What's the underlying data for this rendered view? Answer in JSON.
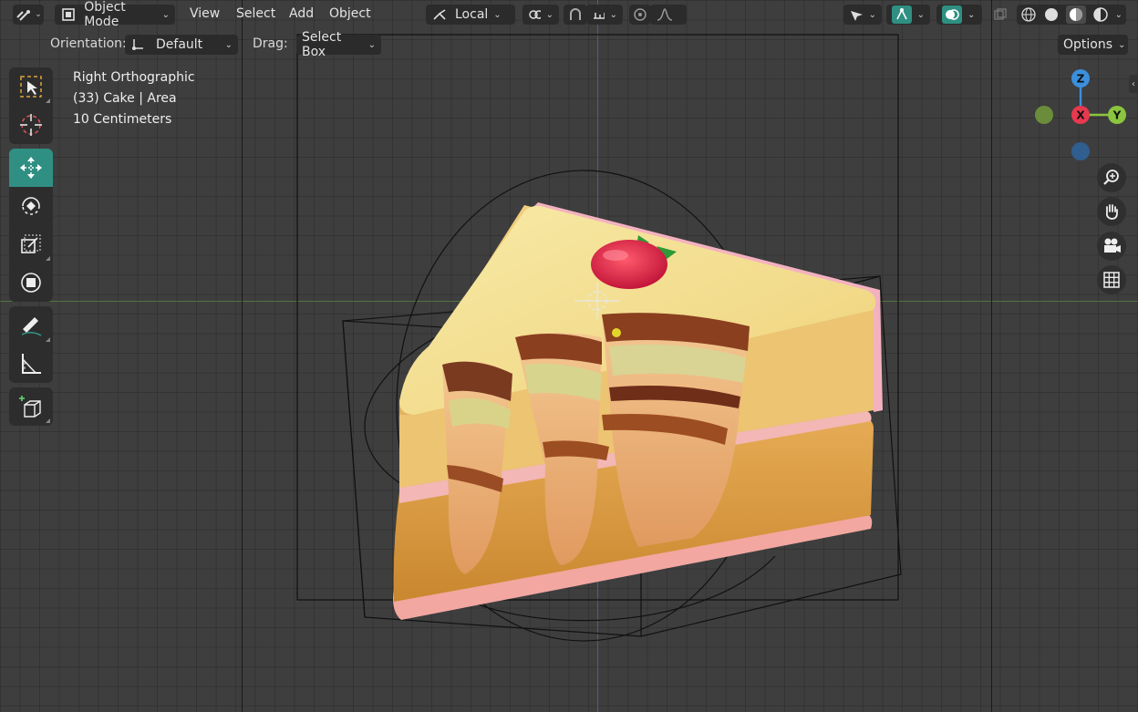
{
  "header": {
    "mode_label": "Object Mode",
    "menus": [
      "View",
      "Select",
      "Add",
      "Object"
    ],
    "transform_orientation": "Local"
  },
  "tool_header": {
    "orientation_label": "Orientation:",
    "orientation_value": "Default",
    "drag_label": "Drag:",
    "drag_value": "Select Box",
    "options_label": "Options"
  },
  "overlay": {
    "view_name": "Right Orthographic",
    "object_info": "(33) Cake | Area",
    "scale_info": "10 Centimeters"
  },
  "gizmo": {
    "z": "Z",
    "x": "X",
    "y": "Y"
  },
  "colors": {
    "accent": "#2f8f82",
    "axis_x": "#e8384f",
    "axis_y": "#8bc53f",
    "axis_z": "#3c8fdc"
  }
}
